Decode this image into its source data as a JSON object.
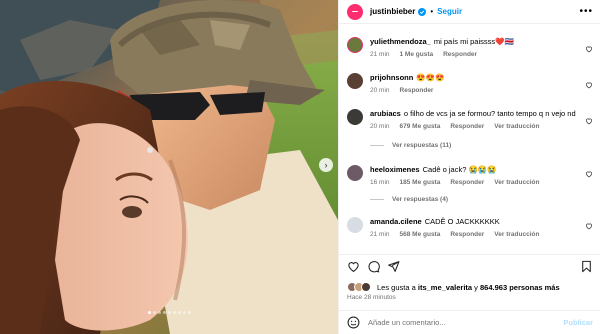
{
  "post": {
    "author": "justinbieber",
    "separator": "•",
    "follow_label": "Seguir",
    "more_label": "•••",
    "carousel": {
      "slides": 9,
      "active": 0,
      "next_label": "›"
    }
  },
  "comments": [
    {
      "user": "yuliethmendoza_",
      "text": "mi país mi paissss❤️🇨🇷",
      "time": "21 min",
      "likes": "1 Me gusta",
      "reply": "Responder",
      "translate": "",
      "avatar_color": "#6b7a3c"
    },
    {
      "user": "prijohnsonn",
      "text": "😍😍😍",
      "time": "20 min",
      "likes": "",
      "reply": "Responder",
      "translate": "",
      "avatar_color": "#5a3f35"
    },
    {
      "user": "arubiacs",
      "text": "o filho de vcs ja se formou? tanto tempo q n vejo nd",
      "time": "20 min",
      "likes": "679 Me gusta",
      "reply": "Responder",
      "translate": "Ver traducción",
      "avatar_color": "#3c3a36",
      "replies_label": "Ver respuestas (11)"
    },
    {
      "user": "heeloximenes",
      "text": "Cadê o jack? 😭😭😭",
      "time": "16 min",
      "likes": "185 Me gusta",
      "reply": "Responder",
      "translate": "Ver traducción",
      "avatar_color": "#6e5a66",
      "replies_label": "Ver respuestas (4)"
    },
    {
      "user": "amanda.cilene",
      "text": "CADÊ O JACKKKKKK",
      "time": "21 min",
      "likes": "568 Me gusta",
      "reply": "Responder",
      "translate": "Ver traducción",
      "avatar_color": "#d8dde3"
    }
  ],
  "likes": {
    "prefix": "Les gusta a",
    "user": "its_me_valerita",
    "conj": "y",
    "count": "864.963 personas más"
  },
  "timestamp": "Hace 28 minutos",
  "composer": {
    "placeholder": "Añade un comentario...",
    "publish_label": "Publicar"
  },
  "colors": {
    "brand_avatar": "#ff2d6f",
    "link": "#0095f6",
    "muted": "#737373"
  }
}
